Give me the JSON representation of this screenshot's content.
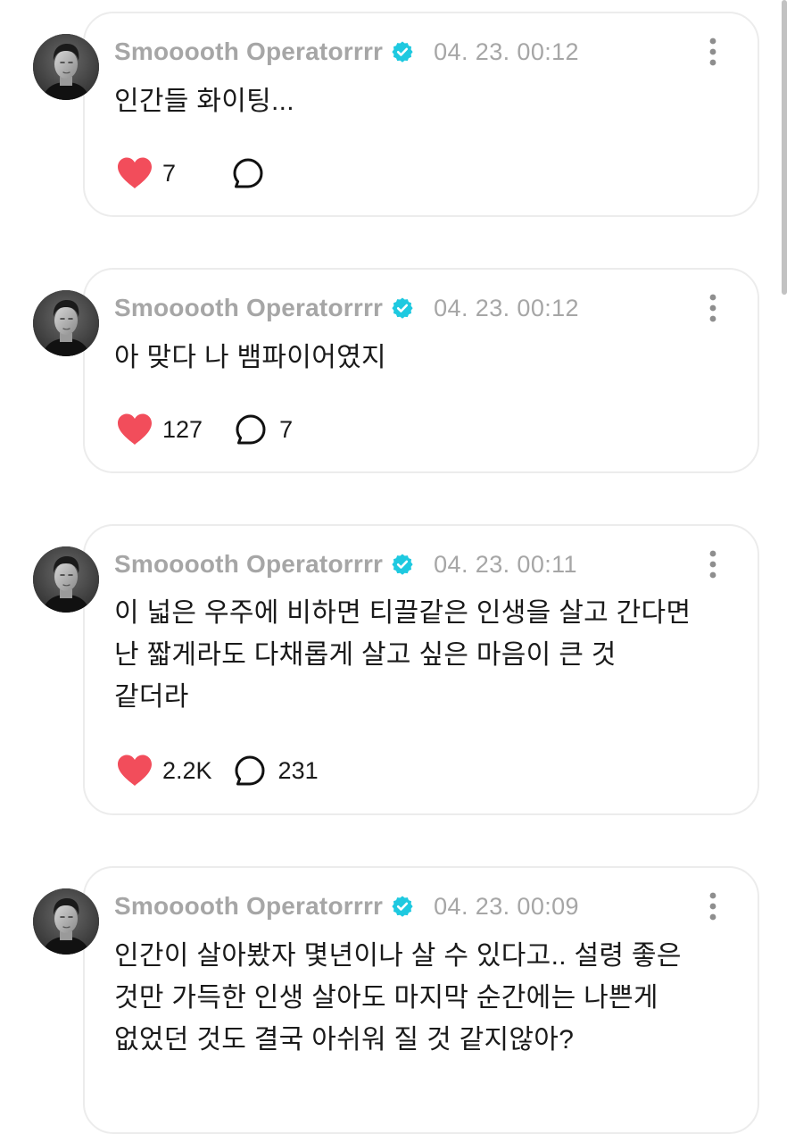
{
  "posts": [
    {
      "username": "Smooooth Operatorrrr",
      "timestamp": "04. 23. 00:12",
      "lines": [
        "인간들 화이팅..."
      ],
      "likes": "7",
      "comments": ""
    },
    {
      "username": "Smooooth Operatorrrr",
      "timestamp": "04. 23. 00:12",
      "lines": [
        "아 맞다 나 뱀파이어였지"
      ],
      "likes": "127",
      "comments": "7"
    },
    {
      "username": "Smooooth Operatorrrr",
      "timestamp": "04. 23. 00:11",
      "lines": [
        "이 넓은 우주에 비하면 티끌같은 인생을 살고 간다면",
        "난 짧게라도 다채롭게 살고 싶은 마음이 큰 것",
        "같더라"
      ],
      "likes": "2.2K",
      "comments": "231"
    },
    {
      "username": "Smooooth Operatorrrr",
      "timestamp": "04. 23. 00:09",
      "lines": [
        "인간이 살아봤자 몇년이나 살 수 있다고.. 설령 좋은",
        "것만 가득한 인생 살아도 마지막 순간에는 나쁜게",
        "없었던 것도 결국 아쉬워 질 것 같지않아?"
      ],
      "likes": "",
      "comments": ""
    }
  ],
  "icons": {
    "avatar": "avatar-photo",
    "verified": "verified-badge-icon",
    "more": "more-options-icon",
    "like": "heart-icon",
    "comment": "comment-bubble-icon"
  },
  "colors": {
    "accent_verified": "#1ec9e0",
    "heart": "#f24d5b",
    "meta_text": "#a6a6a6",
    "body_text": "#1a1a1a",
    "card_border": "#ececec"
  }
}
